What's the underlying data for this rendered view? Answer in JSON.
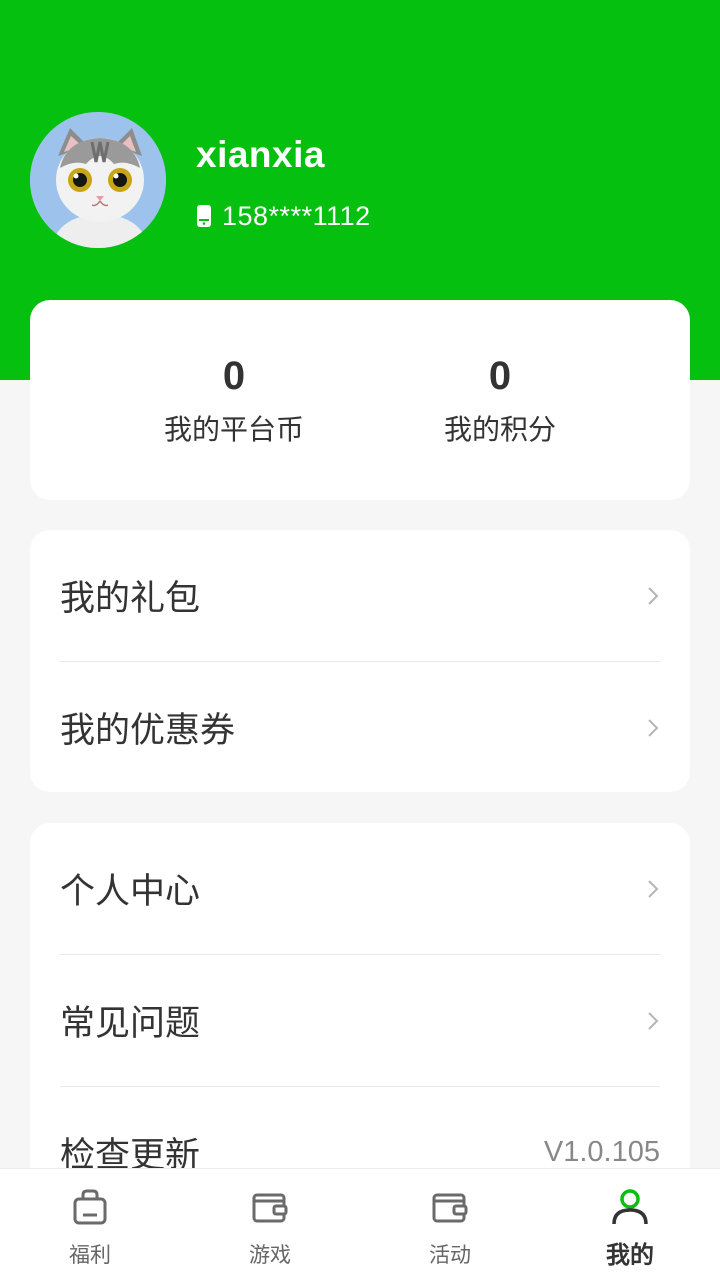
{
  "profile": {
    "username": "xianxia",
    "phone": "158****1112"
  },
  "stats": {
    "coins_value": "0",
    "coins_label": "我的平台币",
    "points_value": "0",
    "points_label": "我的积分"
  },
  "menu_group_1": [
    {
      "label": "我的礼包"
    },
    {
      "label": "我的优惠券"
    }
  ],
  "menu_group_2": [
    {
      "label": "个人中心"
    },
    {
      "label": "常见问题"
    },
    {
      "label": "检查更新",
      "value": "V1.0.105"
    }
  ],
  "tabs": [
    {
      "label": "福利",
      "icon": "bag-icon",
      "active": false
    },
    {
      "label": "游戏",
      "icon": "wallet-icon",
      "active": false
    },
    {
      "label": "活动",
      "icon": "wallet-icon",
      "active": false
    },
    {
      "label": "我的",
      "icon": "user-icon",
      "active": true
    }
  ],
  "colors": {
    "brand_green": "#05c00f",
    "background": "#f6f6f6",
    "text": "#333333"
  }
}
